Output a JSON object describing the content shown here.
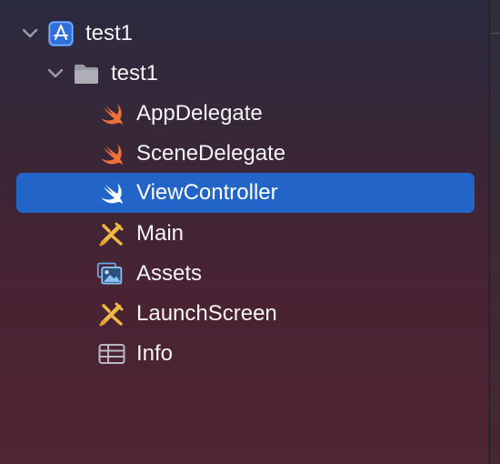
{
  "tree": {
    "project": {
      "label": "test1",
      "icon": "app-project-icon",
      "expanded": true
    },
    "group": {
      "label": "test1",
      "icon": "folder-icon",
      "expanded": true
    },
    "files": [
      {
        "label": "AppDelegate",
        "icon": "swift-icon"
      },
      {
        "label": "SceneDelegate",
        "icon": "swift-icon"
      },
      {
        "label": "ViewController",
        "icon": "swift-icon",
        "selected": true
      },
      {
        "label": "Main",
        "icon": "storyboard-icon"
      },
      {
        "label": "Assets",
        "icon": "asset-catalog-icon"
      },
      {
        "label": "LaunchScreen",
        "icon": "storyboard-icon"
      },
      {
        "label": "Info",
        "icon": "plist-icon"
      }
    ]
  },
  "colors": {
    "selection": "#2364c9",
    "swift_orange": "#f0703c",
    "storyboard_yellow": "#f0b844",
    "asset_blue": "#6aa7e6",
    "project_blue": "#3d86f0"
  }
}
